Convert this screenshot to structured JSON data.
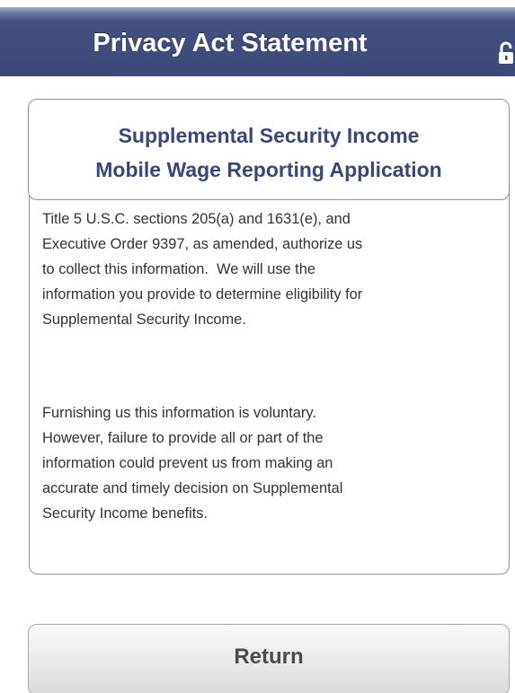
{
  "header": {
    "title": "Privacy Act Statement",
    "lock_icon": "lock-icon"
  },
  "app_title": {
    "line1": "Supplemental Security Income",
    "line2": "Mobile Wage Reporting Application"
  },
  "statement": {
    "paragraph1_lines": [
      "Title 5 U.S.C. sections 205(a) and 1631(e), and",
      "Executive Order 9397, as amended, authorize us",
      "to collect this information.  We will use the",
      "information you provide to determine eligibility for",
      "Supplemental Security Income."
    ],
    "paragraph2_lines": [
      "Furnishing us this information is voluntary.",
      "However, failure to provide all or part of the",
      "information could prevent us from making an",
      "accurate and timely decision on Supplemental",
      "Security Income benefits."
    ]
  },
  "actions": {
    "return_label": "Return"
  },
  "colors": {
    "header_bg": "#3a4878",
    "title_text": "#3a4878",
    "body_text": "#333333",
    "button_text": "#4b4b4b"
  }
}
